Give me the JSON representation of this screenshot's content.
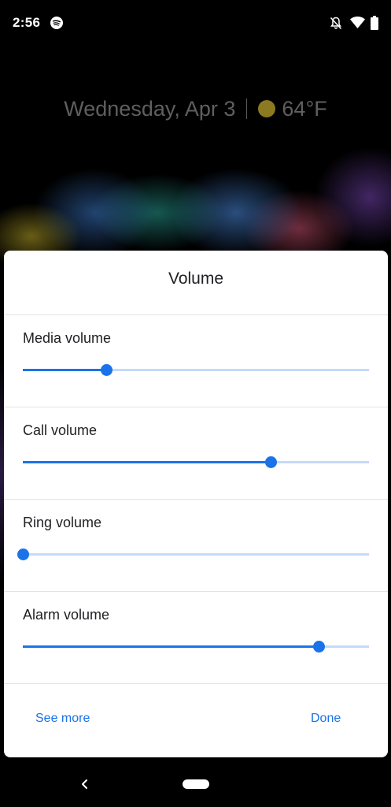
{
  "status_bar": {
    "time": "2:56",
    "icons": [
      "spotify-icon",
      "bell-off-icon",
      "wifi-icon",
      "battery-icon"
    ]
  },
  "lock_screen": {
    "date": "Wednesday, Apr 3",
    "temperature": "64°F",
    "weather_icon": "sun-icon"
  },
  "dialog": {
    "title": "Volume",
    "sliders": [
      {
        "label": "Media volume",
        "level": 0.24
      },
      {
        "label": "Call volume",
        "level": 0.715
      },
      {
        "label": "Ring volume",
        "level": 0.0
      },
      {
        "label": "Alarm volume",
        "level": 0.855
      }
    ],
    "see_more_label": "See more",
    "done_label": "Done"
  },
  "colors": {
    "accent": "#1a73e8",
    "track": "#c4dafa"
  },
  "nav_bar": {
    "icons": [
      "back-icon",
      "home-pill"
    ]
  }
}
